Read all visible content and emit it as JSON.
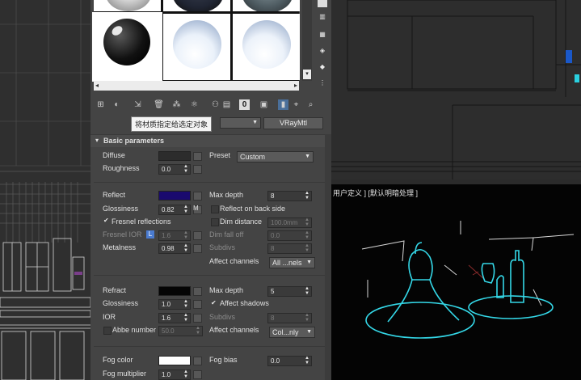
{
  "viewport_label": "用户定义 ] [默认明暗处理 ]",
  "tooltip": "将材质指定给选定对象",
  "material_type_button": "VRayMtl",
  "rollout_title": "Basic parameters",
  "colors": {
    "diffuse": "#2c2c2c",
    "reflect": "#1a0a6e",
    "refract": "#050505",
    "fog": "#ffffff",
    "wireframe": "#34d8e8"
  },
  "diffuse": {
    "label": "Diffuse",
    "roughness_label": "Roughness",
    "roughness": "0.0",
    "preset_label": "Preset",
    "preset": "Custom"
  },
  "reflect": {
    "label": "Reflect",
    "glossiness_label": "Glossiness",
    "glossiness": "0.82",
    "m": "M",
    "fresnel": "Fresnel reflections",
    "fresnel_ior_label": "Fresnel IOR",
    "l": "L",
    "fresnel_ior": "1.6",
    "metalness_label": "Metalness",
    "metalness": "0.98",
    "max_depth_label": "Max depth",
    "max_depth": "8",
    "back_side": "Reflect on back side",
    "dim_distance_label": "Dim distance",
    "dim_distance": "100.0mm",
    "dim_falloff_label": "Dim fall off",
    "dim_falloff": "0.0",
    "subdivs_label": "Subdivs",
    "subdivs": "8",
    "affect_channels_label": "Affect channels",
    "affect_channels": "All ...nels"
  },
  "refract": {
    "label": "Refract",
    "glossiness_label": "Glossiness",
    "glossiness": "1.0",
    "ior_label": "IOR",
    "ior": "1.6",
    "abbe_label": "Abbe number",
    "abbe": "50.0",
    "max_depth_label": "Max depth",
    "max_depth": "5",
    "affect_shadows": "Affect shadows",
    "subdivs_label": "Subdivs",
    "subdivs": "8",
    "affect_channels_label": "Affect channels",
    "affect_channels": "Col...nly"
  },
  "fog": {
    "color_label": "Fog color",
    "bias_label": "Fog bias",
    "bias": "0.0",
    "multiplier_label": "Fog multiplier",
    "multiplier": "1.0"
  }
}
